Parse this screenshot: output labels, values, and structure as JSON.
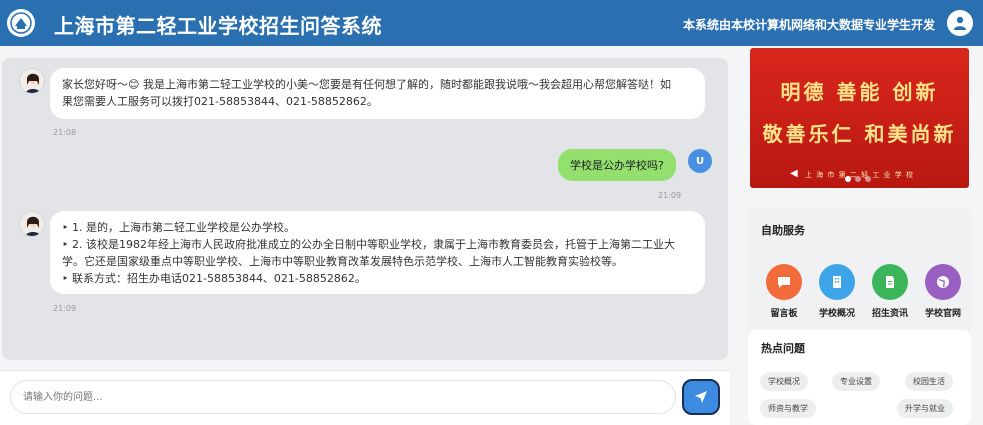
{
  "header": {
    "title": "上海市第二轻工业学校招生问答系统",
    "note": "本系统由本校计算机网络和大数据专业学生开发",
    "logo_icon": "school-logo-icon",
    "user_icon": "user-icon",
    "bg_color": "#2a6fb0"
  },
  "chat": {
    "messages": [
      {
        "role": "bot",
        "lines": [
          "家长您好呀～😊 我是上海市第二轻工业学校的小美～您要是有任何想了解的，随时都能跟我说哦～我会超用心帮您解答哒！如",
          "果您需要人工服务可以拨打021-58853844、021-58852862。"
        ],
        "time": "21:08"
      },
      {
        "role": "user",
        "text": "学校是公办学校吗?",
        "avatar": "U",
        "time": "21:09"
      },
      {
        "role": "bot",
        "lines": [
          "‣ 1. 是的，上海市第二轻工业学校是公办学校。",
          "‣ 2. 该校是1982年经上海市人民政府批准成立的公办全日制中等职业学校，隶属于上海市教育委员会，托管于上海第二工业大",
          "学。它还是国家级重点中等职业学校、上海市中等职业教育改革发展特色示范学校、上海市人工智能教育实验校等。",
          "‣  联系方式：招生办电话021-58853844、021-58852862。"
        ],
        "time": "21:09"
      }
    ]
  },
  "input": {
    "placeholder": "请输入你的问题...",
    "send_icon": "send-icon"
  },
  "banner": {
    "line1": "明德 善能 创新",
    "line2": "敬善乐仁 和美尚新",
    "caption": "上 海 市 第 二 轻 工 业 学 校"
  },
  "self_service": {
    "title": "自助服务",
    "items": [
      {
        "label": "留言板",
        "icon": "chat-bubble-icon",
        "color": "#f26b3a"
      },
      {
        "label": "学校概况",
        "icon": "building-icon",
        "color": "#3da4e8"
      },
      {
        "label": "招生资讯",
        "icon": "document-icon",
        "color": "#3cb55a"
      },
      {
        "label": "学校官网",
        "icon": "globe-icon",
        "color": "#9a5fc2"
      }
    ]
  },
  "hot_topics": {
    "title": "热点问题",
    "tags": [
      "学校概况",
      "专业设置",
      "校园生活",
      "师资与教学",
      "升学与就业"
    ]
  }
}
